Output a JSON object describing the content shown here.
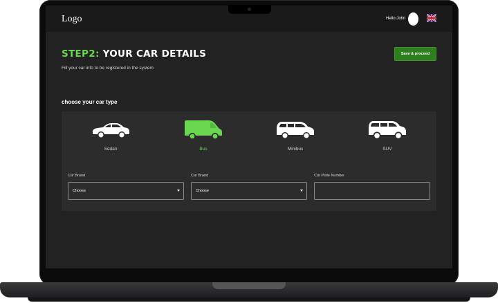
{
  "navbar": {
    "logo": "Logo",
    "greeting": "Hello John",
    "language_icon": "uk-flag-icon"
  },
  "header": {
    "step": "STEP2:",
    "title": "YOUR CAR DETAILS",
    "subtitle": "Fill your car info to be registered in the system",
    "proceed_label": "Save & proceed"
  },
  "car_type": {
    "label": "choose your car type",
    "options": [
      {
        "label": "Sedan",
        "icon": "sedan-icon",
        "selected": false
      },
      {
        "label": "Bus",
        "icon": "van-icon",
        "selected": true
      },
      {
        "label": "Minibus",
        "icon": "minibus-icon",
        "selected": false
      },
      {
        "label": "SUV",
        "icon": "suv-icon",
        "selected": false
      }
    ]
  },
  "form": {
    "brand_1": {
      "label": "Car Brand",
      "value": "Choose"
    },
    "brand_2": {
      "label": "Car Brand",
      "value": "Choose"
    },
    "plate": {
      "label": "Car Plate Number",
      "value": ""
    }
  },
  "colors": {
    "accent": "#6bd650",
    "button": "#2e7d1e",
    "background": "#222222",
    "panel": "#2c2c2c"
  }
}
